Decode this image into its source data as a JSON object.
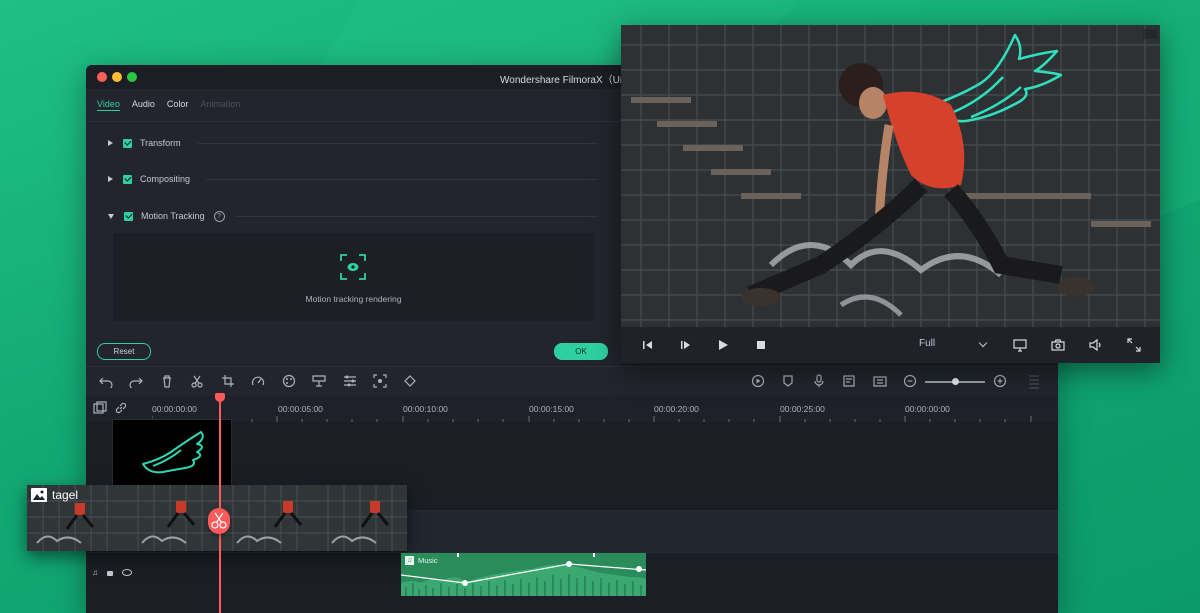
{
  "window": {
    "title": "Wondershare FilmoraX（Untit"
  },
  "properties": {
    "tabs": [
      {
        "label": "Video"
      },
      {
        "label": "Audio"
      },
      {
        "label": "Color"
      },
      {
        "label": "Animation"
      }
    ],
    "sections": [
      {
        "label": "Transform",
        "checked": true,
        "expanded": false
      },
      {
        "label": "Compositing",
        "checked": true,
        "expanded": false
      },
      {
        "label": "Motion Tracking",
        "checked": true,
        "expanded": true
      }
    ],
    "motion_tracking_status": "Motion tracking rendering",
    "reset_label": "Reset",
    "ok_label": "OK"
  },
  "toolbar": {
    "left_icons": [
      "undo-icon",
      "redo-icon",
      "delete-icon",
      "cut-icon",
      "crop-icon",
      "speed-icon",
      "color-icon",
      "green-screen-icon",
      "adjust-icon",
      "motion-tracking-icon",
      "keyframe-icon"
    ],
    "right_icons": [
      "render-icon",
      "marker-icon",
      "voiceover-icon",
      "audio-mixer-icon",
      "snapshot-icon",
      "zoom-out-icon",
      "zoom-in-icon"
    ],
    "zoom_level": 0.5
  },
  "ruler": {
    "labels": [
      "00:00:00:00",
      "00:00:05:00",
      "00:00:10:00",
      "00:00:15:00",
      "00:00:20:00",
      "00:00:25:00",
      "00:00:00:00"
    ]
  },
  "timeline": {
    "video_clip_label": "tagel",
    "music_clip_label": "Music"
  },
  "preview": {
    "quality": "Full",
    "controls": [
      "previous-frame-icon",
      "next-frame-icon",
      "play-icon",
      "stop-icon",
      "display-icon",
      "camera-icon",
      "volume-icon",
      "fullscreen-icon"
    ]
  },
  "colors": {
    "accent": "#2fd0a0",
    "playhead": "#ff5a5a",
    "music_clip": "#2a8c5b",
    "background": "#14a874"
  }
}
